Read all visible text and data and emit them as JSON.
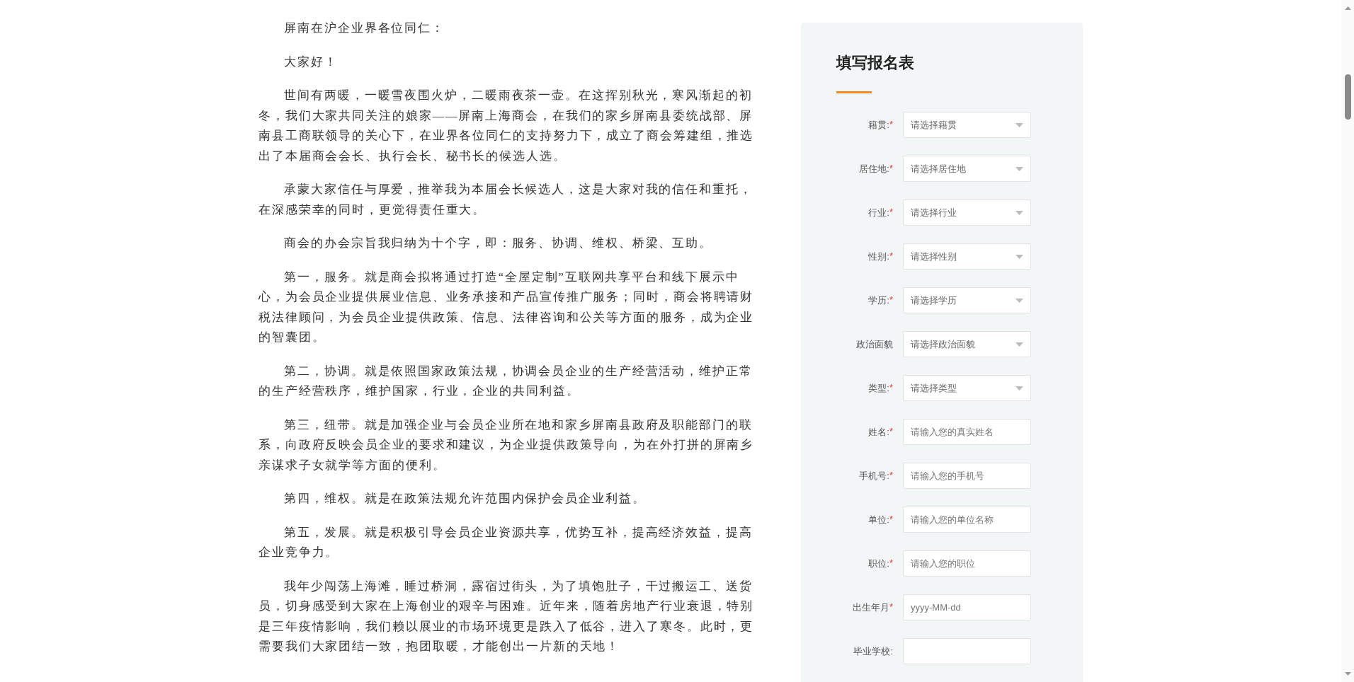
{
  "article": {
    "paragraphs": [
      "屏南在沪企业界各位同仁：",
      "大家好！",
      "世间有两暖，一暖雪夜围火炉，二暖雨夜茶一壶。在这挥别秋光，寒风渐起的初冬，我们大家共同关注的娘家——屏南上海商会，在我们的家乡屏南县委统战部、屏南县工商联领导的关心下，在业界各位同仁的支持努力下，成立了商会筹建组，推选出了本届商会会长、执行会长、秘书长的候选人选。",
      "承蒙大家信任与厚爱，推举我为本届会长候选人，这是大家对我的信任和重托，在深感荣幸的同时，更觉得责任重大。",
      "商会的办会宗旨我归纳为十个字，即：服务、协调、维权、桥梁、互助。",
      "第一，服务。就是商会拟将通过打造“全屋定制”互联网共享平台和线下展示中心，为会员企业提供展业信息、业务承接和产品宣传推广服务；同时，商会将聘请财税法律顾问，为会员企业提供政策、信息、法律咨询和公关等方面的服务，成为企业的智囊团。",
      "第二，协调。就是依照国家政策法规，协调会员企业的生产经营活动，维护正常的生产经营秩序，维护国家，行业，企业的共同利益。",
      "第三，纽带。就是加强企业与会员企业所在地和家乡屏南县政府及职能部门的联系，向政府反映会员企业的要求和建议，为企业提供政策导向，为在外打拼的屏南乡亲谋求子女就学等方面的便利。",
      "第四，维权。就是在政策法规允许范围内保护会员企业利益。",
      "第五，发展。就是积极引导会员企业资源共享，优势互补，提高经济效益，提高企业竞争力。",
      "我年少闯荡上海滩，睡过桥洞，露宿过街头，为了填饱肚子，干过搬运工、送货员，切身感受到大家在上海创业的艰辛与困难。近年来，随着房地产行业衰退，特别是三年疫情影响，我们赖以展业的市场环境更是跌入了低谷，进入了寒冬。此时，更需要我们大家团结一致，抱团取暖，才能创出一片新的天地！"
    ]
  },
  "form": {
    "title": "填写报名表",
    "fields": [
      {
        "kind": "select",
        "label": "籍贯:",
        "mark": "*",
        "placeholder": "请选择籍贯"
      },
      {
        "kind": "select",
        "label": "居住地:",
        "mark": "*",
        "placeholder": "请选择居住地"
      },
      {
        "kind": "select",
        "label": "行业:",
        "mark": "*",
        "placeholder": "请选择行业"
      },
      {
        "kind": "select",
        "label": "性别:",
        "mark": "*",
        "placeholder": "请选择性别"
      },
      {
        "kind": "select",
        "label": "学历:",
        "mark": "*",
        "placeholder": "请选择学历"
      },
      {
        "kind": "select",
        "label": "政治面貌",
        "placeholder": "请选择政治面貌"
      },
      {
        "kind": "select",
        "label": "类型:",
        "mark": "*",
        "placeholder": "请选择类型"
      },
      {
        "kind": "text",
        "label": "姓名:",
        "mark": "*",
        "placeholder": "请输入您的真实姓名"
      },
      {
        "kind": "text",
        "label": "手机号:",
        "mark": "*",
        "placeholder": "请输入您的手机号"
      },
      {
        "kind": "text",
        "label": "单位:",
        "mark": "*",
        "placeholder": "请输入您的单位名称"
      },
      {
        "kind": "text",
        "label": "职位:",
        "mark": "*",
        "placeholder": "请输入您的职位"
      },
      {
        "kind": "date",
        "label": "出生年月",
        "mark": "*",
        "placeholder": "yyyy-MM-dd"
      },
      {
        "kind": "text",
        "label": "毕业学校:"
      }
    ]
  }
}
